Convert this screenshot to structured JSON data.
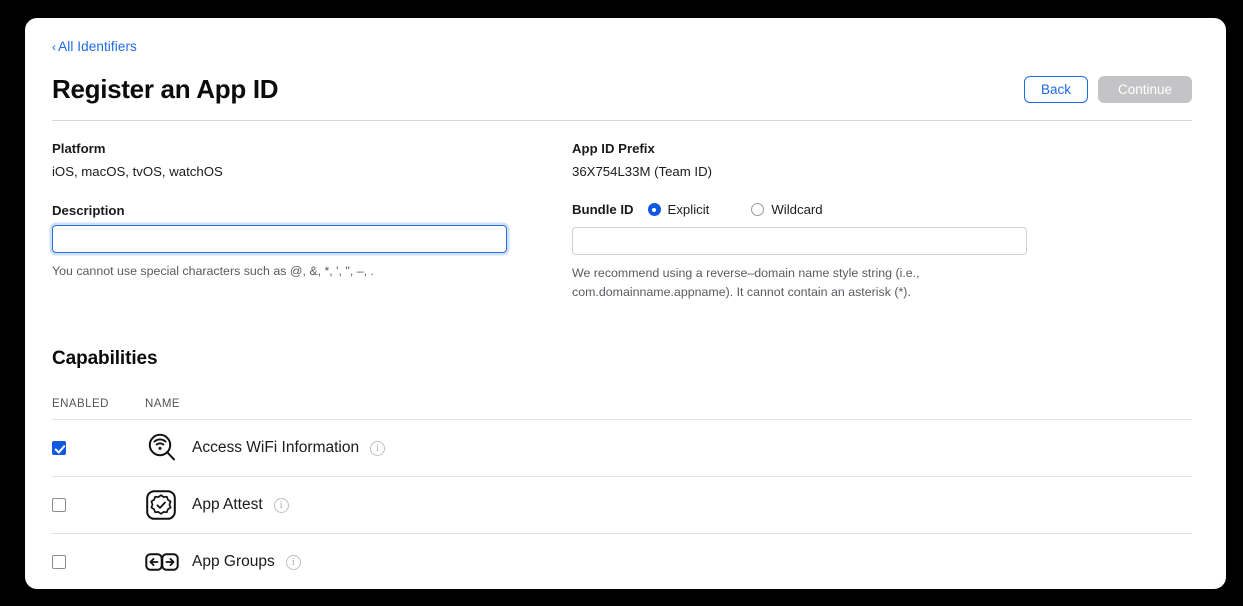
{
  "breadcrumb": {
    "chevron": "‹",
    "label": "All Identifiers"
  },
  "header": {
    "title": "Register an App ID",
    "back_label": "Back",
    "continue_label": "Continue"
  },
  "form": {
    "platform_label": "Platform",
    "platform_value": "iOS, macOS, tvOS, watchOS",
    "description_label": "Description",
    "description_value": "",
    "description_placeholder": "",
    "description_helper": "You cannot use special characters such as @, &, *, ', \", –, .",
    "prefix_label": "App ID Prefix",
    "prefix_value": "36X754L33M (Team ID)",
    "bundle_label": "Bundle ID",
    "bundle_options": [
      {
        "label": "Explicit",
        "selected": true
      },
      {
        "label": "Wildcard",
        "selected": false
      }
    ],
    "bundle_value": "",
    "bundle_placeholder": "",
    "bundle_helper_line1": "We recommend using a reverse–domain name style string (i.e.,",
    "bundle_helper_line2": "com.domainname.appname). It cannot contain an asterisk (*)."
  },
  "capabilities": {
    "section_title": "Capabilities",
    "col_enabled": "ENABLED",
    "col_name": "NAME",
    "rows": [
      {
        "name": "Access WiFi Information",
        "enabled": true,
        "icon": "wifi-magnifier-icon",
        "info": "i"
      },
      {
        "name": "App Attest",
        "enabled": false,
        "icon": "app-attest-badge-icon",
        "info": "i"
      },
      {
        "name": "App Groups",
        "enabled": false,
        "icon": "app-groups-arrows-icon",
        "info": "i"
      }
    ]
  },
  "colors": {
    "accent_blue": "#1d6ae5",
    "control_blue": "#1058e0",
    "disabled_gray": "#c4c4c6",
    "rule_gray": "#e2e2e6",
    "text_dark": "#1b1b1d",
    "text_muted": "#545458"
  }
}
